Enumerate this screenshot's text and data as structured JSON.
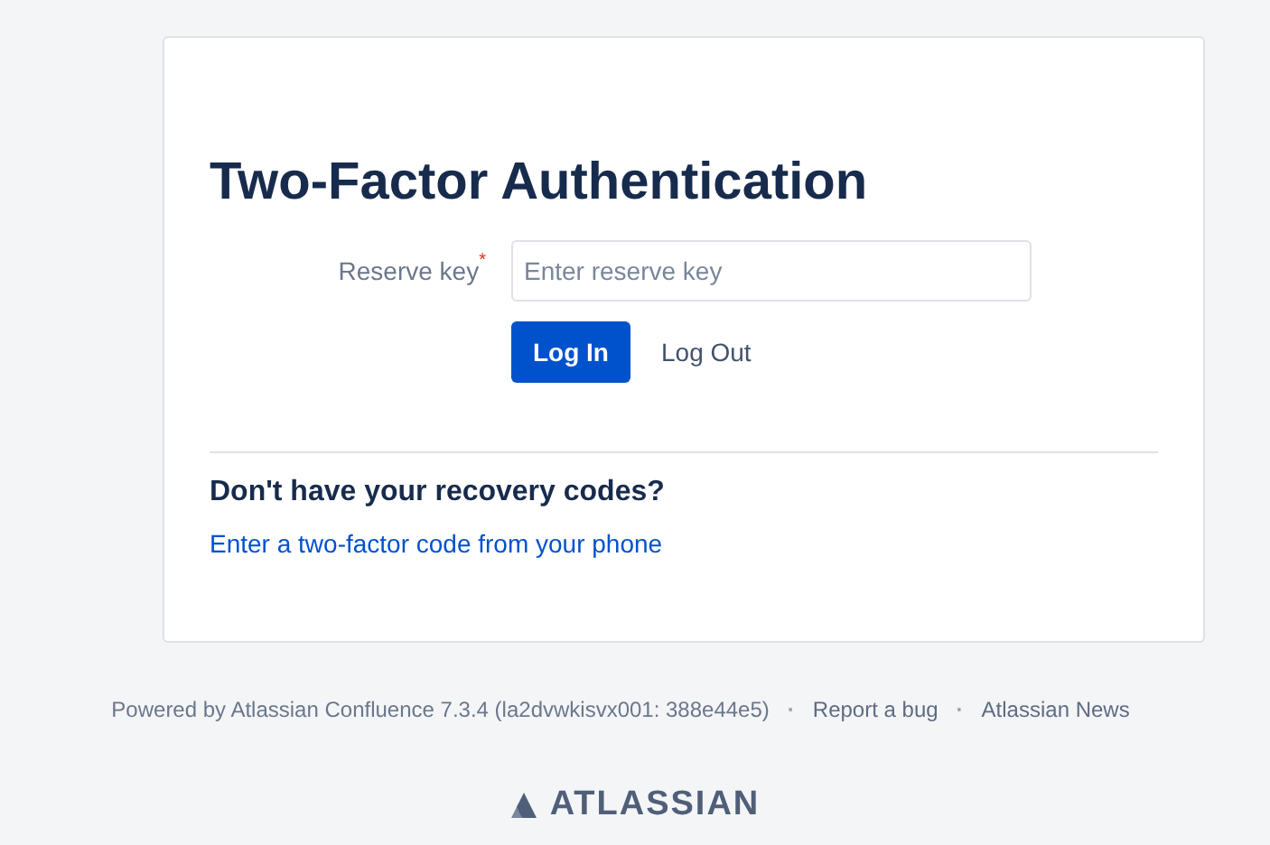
{
  "title": "Two-Factor Authentication",
  "field": {
    "label": "Reserve key",
    "required_mark": "*",
    "placeholder": "Enter reserve key"
  },
  "buttons": [
    {
      "label": "Log In",
      "kind": "primary"
    },
    {
      "label": "Log Out",
      "kind": "link"
    }
  ],
  "recovery": {
    "heading": "Don't have your recovery codes?",
    "link": "Enter a two-factor code from your phone"
  },
  "footer": {
    "items": [
      {
        "kind": "text",
        "label": "Powered by Atlassian Confluence 7.3.4 (la2dvwkisvx001: 388e44e5)"
      },
      {
        "kind": "separator",
        "label": "·"
      },
      {
        "kind": "link",
        "label": "Report a bug"
      },
      {
        "kind": "separator",
        "label": "·"
      },
      {
        "kind": "link",
        "label": "Atlassian News"
      }
    ],
    "logo": "ATLASSIAN"
  }
}
